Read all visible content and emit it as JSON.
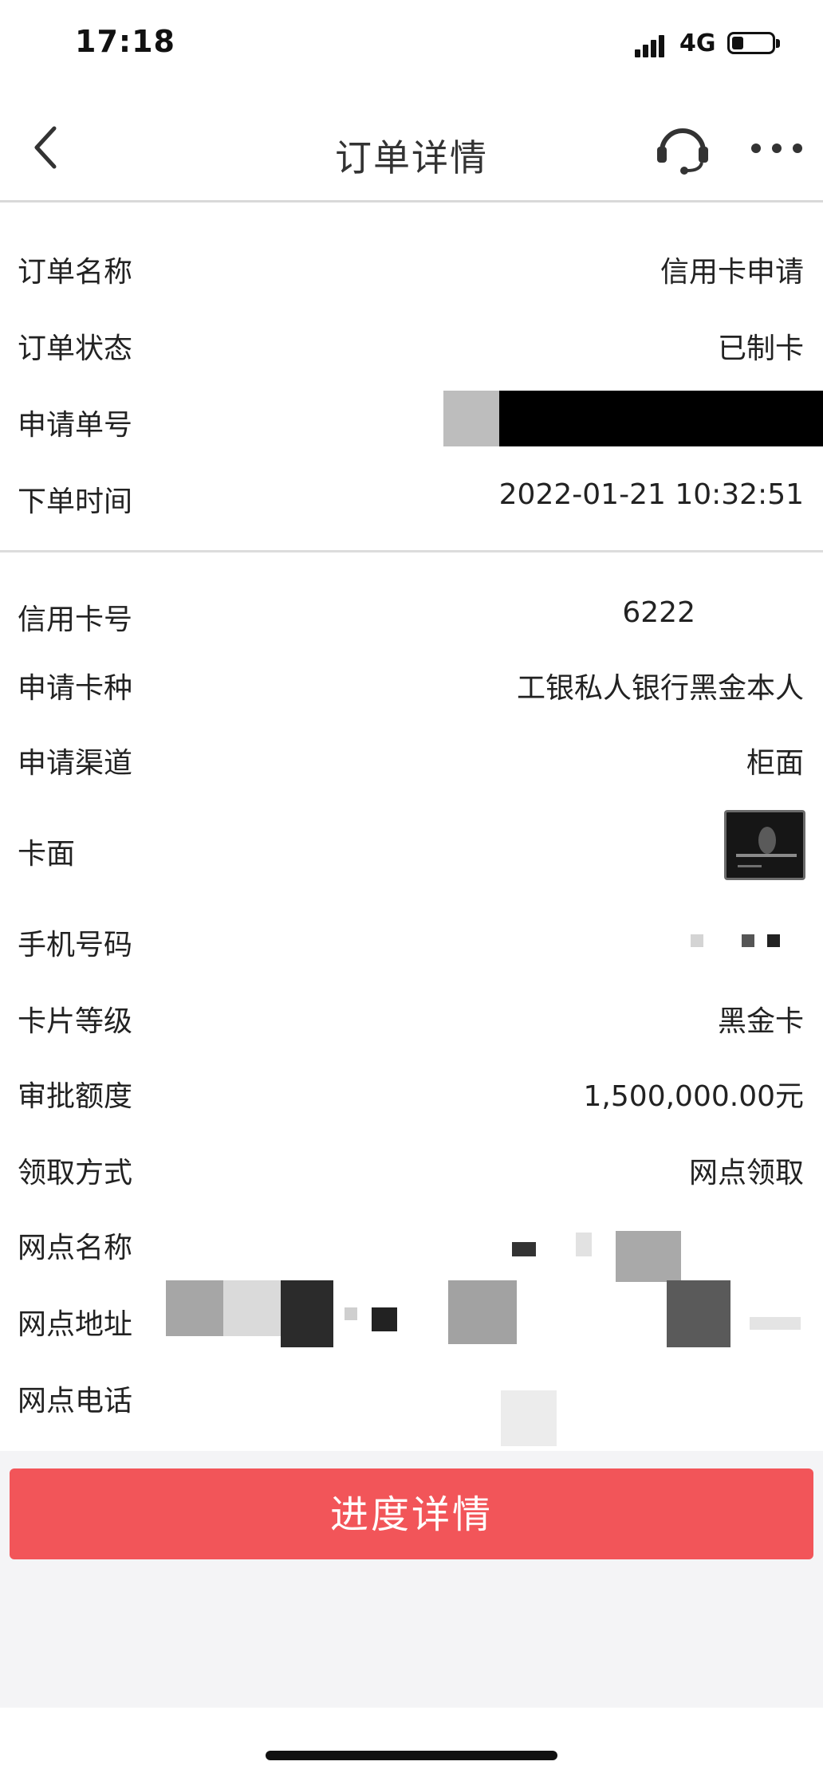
{
  "status_bar": {
    "time": "17:18",
    "network": "4G"
  },
  "nav": {
    "title": "订单详情"
  },
  "order": [
    {
      "label": "订单名称",
      "value": "信用卡申请"
    },
    {
      "label": "订单状态",
      "value": "已制卡"
    },
    {
      "label": "申请单号",
      "value": ""
    },
    {
      "label": "下单时间",
      "value": "2022-01-21 10:32:51"
    }
  ],
  "card": [
    {
      "label": "信用卡号",
      "value": "6222"
    },
    {
      "label": "申请卡种",
      "value": "工银私人银行黑金本人"
    },
    {
      "label": "申请渠道",
      "value": "柜面"
    },
    {
      "label": "卡面",
      "value": ""
    },
    {
      "label": "手机号码",
      "value": ""
    },
    {
      "label": "卡片等级",
      "value": "黑金卡"
    },
    {
      "label": "审批额度",
      "value": "1,500,000.00元"
    },
    {
      "label": "领取方式",
      "value": "网点领取"
    },
    {
      "label": "网点名称",
      "value": ""
    },
    {
      "label": "网点地址",
      "value": ""
    },
    {
      "label": "网点电话",
      "value": ""
    }
  ],
  "button": {
    "label": "进度详情"
  },
  "icons": {
    "back": "chevron-left-icon",
    "service": "headset-icon",
    "more": "more-dots-icon"
  },
  "colors": {
    "accent": "#f25559",
    "background": "#ffffff",
    "footer_bg": "#f4f4f6"
  }
}
